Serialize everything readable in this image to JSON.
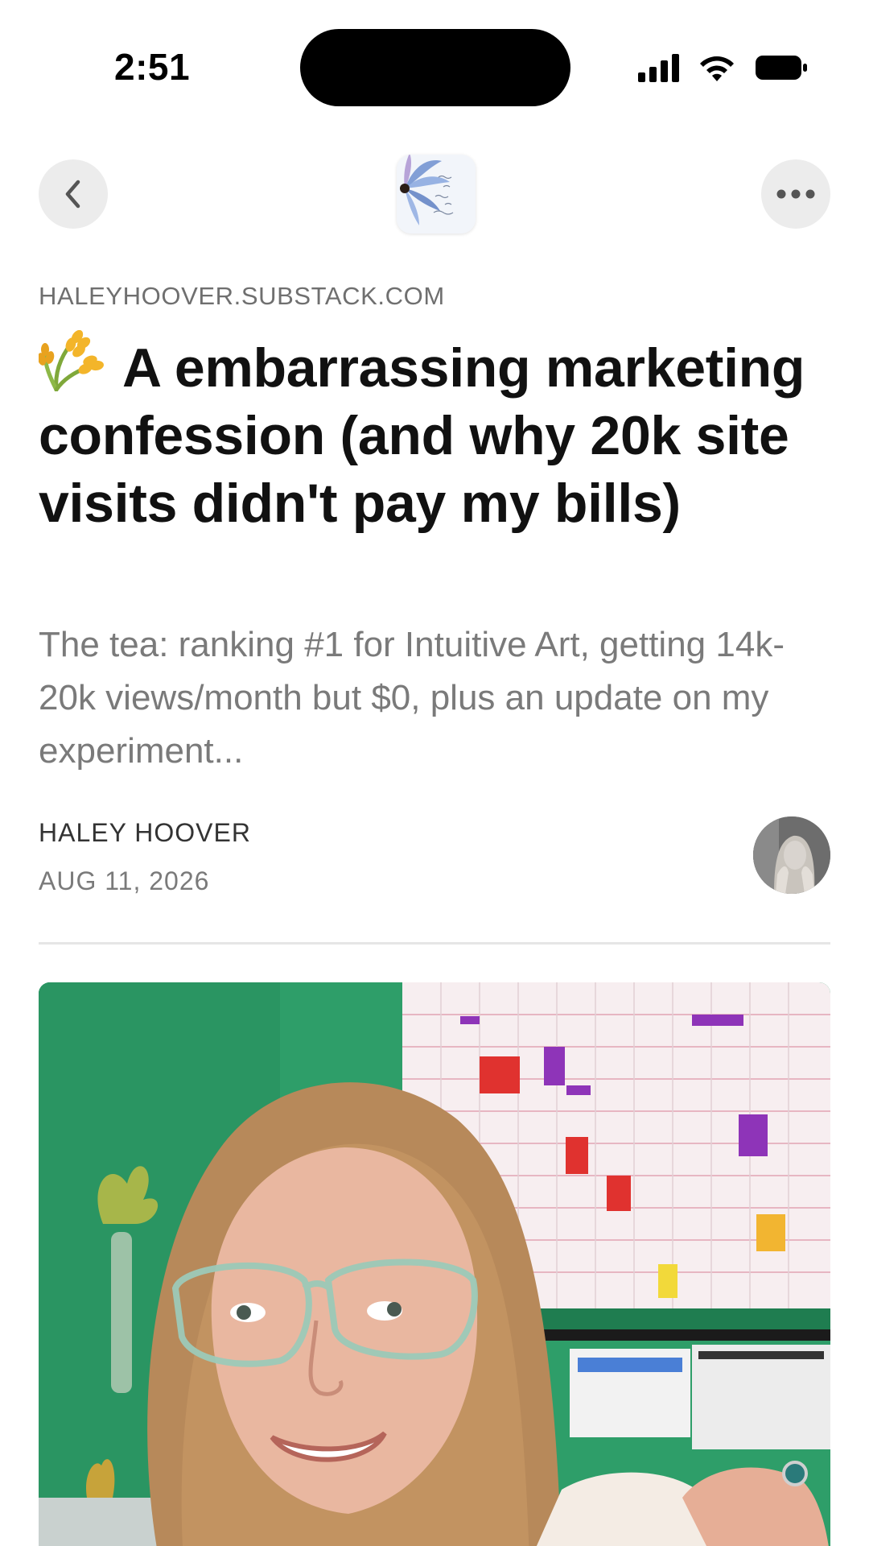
{
  "status_bar": {
    "time": "2:51",
    "icons": [
      "signal-icon",
      "wifi-icon",
      "battery-icon"
    ]
  },
  "nav": {
    "back_icon": "chevron-left-icon",
    "more_icon": "more-horizontal-icon",
    "publication_logo": "flower-logo"
  },
  "article": {
    "publication": "HALEYHOOVER.SUBSTACK.COM",
    "title_emoji_icon": "wheat-icon",
    "title": "A embarrassing marketing confession (and why 20k site visits didn't pay my bills)",
    "subtitle": "The tea: ranking #1 for Intuitive Art, getting 14k-20k views/month but $0, plus an update on my experiment...",
    "author": "HALEY HOOVER",
    "date": "AUG 11, 2026"
  },
  "colors": {
    "title": "#111111",
    "subtitle": "#7a7a7a",
    "meta": "#6f6f6f",
    "button_bg": "#ececec",
    "divider": "#e6e6e6"
  }
}
